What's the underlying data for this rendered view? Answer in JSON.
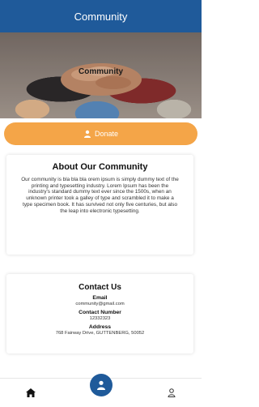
{
  "header": {
    "title": "Community"
  },
  "hero": {
    "label": "Community"
  },
  "join_button": {
    "label": "Donate",
    "icon": "person-icon"
  },
  "about": {
    "title": "About Our Community",
    "body": "Our community is bla bla bla orem ipsum is simply dummy text of the printing and typesetting industry. Lorem Ipsum has been the industry's standard dummy text ever since the 1500s, when an unknown printer took a galley of type and scrambled it to make a type specimen book. It has survived not only five centuries, but also the leap into electronic typesetting."
  },
  "contact": {
    "title": "Contact Us",
    "email_label": "Email",
    "email_value": "community@gmail.com",
    "phone_label": "Contact Number",
    "phone_value": "12332323",
    "address_label": "Address",
    "address_value": "768 Fairway Drive, GUTTENBERG, 50052"
  },
  "bottom_nav": {
    "items": [
      {
        "name": "home",
        "icon": "home-icon"
      },
      {
        "name": "community",
        "icon": "community-icon"
      },
      {
        "name": "profile",
        "icon": "user-icon"
      }
    ]
  },
  "colors": {
    "header_bg": "#1f5a9a",
    "accent_orange": "#f4a548",
    "nav_active": "#1f5a9a"
  }
}
